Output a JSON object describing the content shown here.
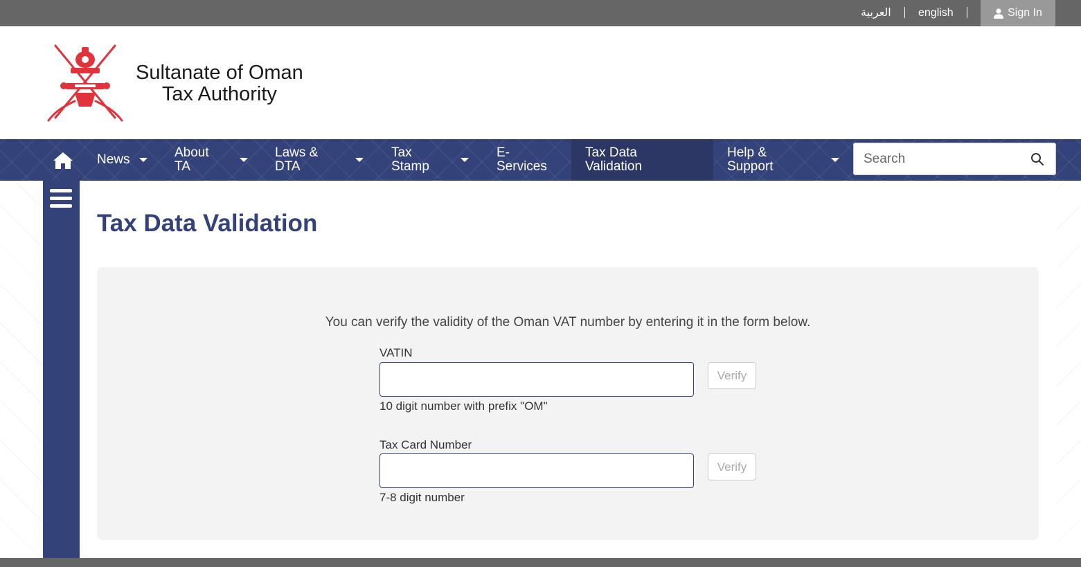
{
  "topbar": {
    "lang_arabic": "العربية",
    "lang_english": "english",
    "signin_label": "Sign In"
  },
  "header": {
    "line1": "Sultanate of Oman",
    "line2": "Tax Authority"
  },
  "nav": {
    "items": [
      {
        "label": "News",
        "has_dropdown": true
      },
      {
        "label": "About TA",
        "has_dropdown": true
      },
      {
        "label": "Laws & DTA",
        "has_dropdown": true
      },
      {
        "label": "Tax Stamp",
        "has_dropdown": true
      },
      {
        "label": "E-Services",
        "has_dropdown": false
      },
      {
        "label": "Tax Data Validation",
        "has_dropdown": false,
        "active": true
      },
      {
        "label": "Help & Support",
        "has_dropdown": true
      }
    ],
    "search_placeholder": "Search"
  },
  "page": {
    "title": "Tax Data Validation",
    "intro": "You can verify the validity of the Oman VAT number by entering it in the form below.",
    "vatin": {
      "label": "VATIN",
      "value": "",
      "hint": "10 digit number with prefix \"OM\"",
      "button": "Verify"
    },
    "taxcard": {
      "label": "Tax Card Number",
      "value": "",
      "hint": "7-8 digit number",
      "button": "Verify"
    }
  },
  "colors": {
    "brand_navy": "#34427a",
    "topbar_gray": "#666666",
    "emblem_red": "#e0333c"
  }
}
